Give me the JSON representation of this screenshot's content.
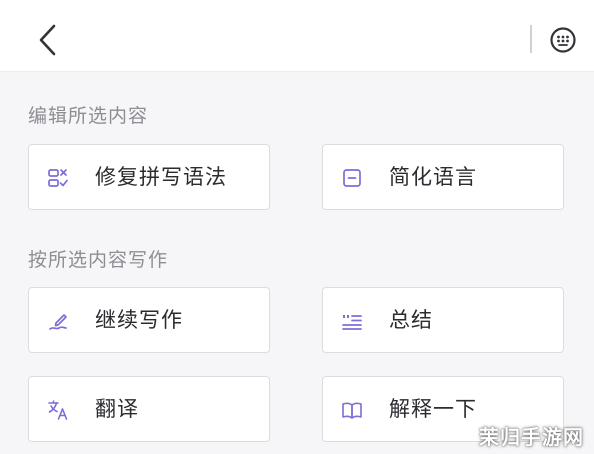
{
  "header": {
    "back_icon": "chevron-left-icon",
    "more_icon": "keyboard-icon"
  },
  "sections": [
    {
      "title": "编辑所选内容",
      "items": [
        {
          "label": "修复拼写语法",
          "icon": "spell-check-icon"
        },
        {
          "label": "简化语言",
          "icon": "minus-square-icon"
        }
      ]
    },
    {
      "title": "按所选内容写作",
      "items": [
        {
          "label": "继续写作",
          "icon": "pen-icon"
        },
        {
          "label": "总结",
          "icon": "list-quote-icon"
        },
        {
          "label": "翻译",
          "icon": "translate-icon"
        },
        {
          "label": "解释一下",
          "icon": "book-icon"
        }
      ]
    }
  ],
  "watermark": "茉归手游网",
  "colors": {
    "accent": "#7b6ed6",
    "background": "#f6f6f8",
    "card_border": "#dcdce0",
    "text": "#2b2b30",
    "section_text": "#8d8d94"
  }
}
